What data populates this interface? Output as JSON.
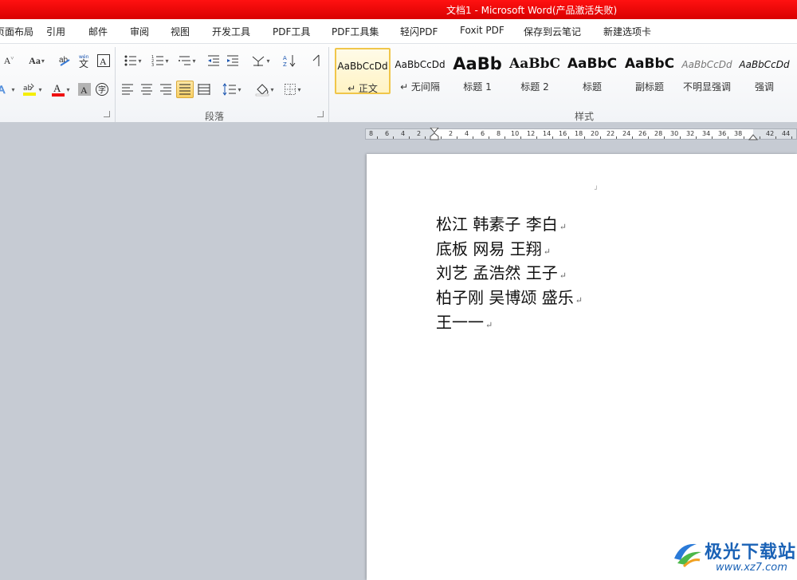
{
  "window": {
    "title": "文档1 - Microsoft Word(产品激活失败)"
  },
  "menu": {
    "tabs": [
      "页面布局",
      "引用",
      "邮件",
      "审阅",
      "视图",
      "开发工具",
      "PDF工具",
      "PDF工具集",
      "轻闪PDF",
      "Foxit PDF",
      "保存到云笔记",
      "新建选项卡"
    ]
  },
  "ribbon": {
    "font_group": {
      "change_case": "Aa",
      "grow_font": "A"
    },
    "paragraph_group": {
      "label": "段落"
    },
    "styles_group": {
      "label": "样式",
      "items": [
        {
          "sample": "AaBbCcDd",
          "name": "↵ 正文",
          "active": true
        },
        {
          "sample": "AaBbCcDd",
          "name": "↵ 无间隔"
        },
        {
          "sample": "AaBb",
          "name": "标题 1"
        },
        {
          "sample": "AaBbC",
          "name": "标题 2"
        },
        {
          "sample": "AaBbC",
          "name": "标题"
        },
        {
          "sample": "AaBbC",
          "name": "副标题"
        },
        {
          "sample": "AaBbCcDd",
          "name": "不明显强调"
        },
        {
          "sample": "AaBbCcDd",
          "name": "强调"
        }
      ]
    }
  },
  "ruler": {
    "labels": [
      "8",
      "6",
      "4",
      "2",
      "2",
      "4",
      "6",
      "8",
      "10",
      "12",
      "14",
      "16",
      "18",
      "20",
      "22",
      "24",
      "26",
      "28",
      "30",
      "32",
      "34",
      "36",
      "38",
      "42",
      "44"
    ]
  },
  "document": {
    "lines": [
      "松江 韩素子 李白",
      "底板 网易 王翔",
      "刘艺 孟浩然 王子",
      "柏子刚 吴博颂 盛乐",
      "王一一"
    ],
    "paragraph_mark": "↵",
    "corner_mark": "┘"
  },
  "watermark": {
    "brand": "极光下载站",
    "url": "www.xz7.com"
  },
  "colors": {
    "title_bar": "#e60000",
    "workspace": "#c6cbd3",
    "active_style_border": "#f0c64a",
    "watermark_blue": "#1a62b6"
  }
}
